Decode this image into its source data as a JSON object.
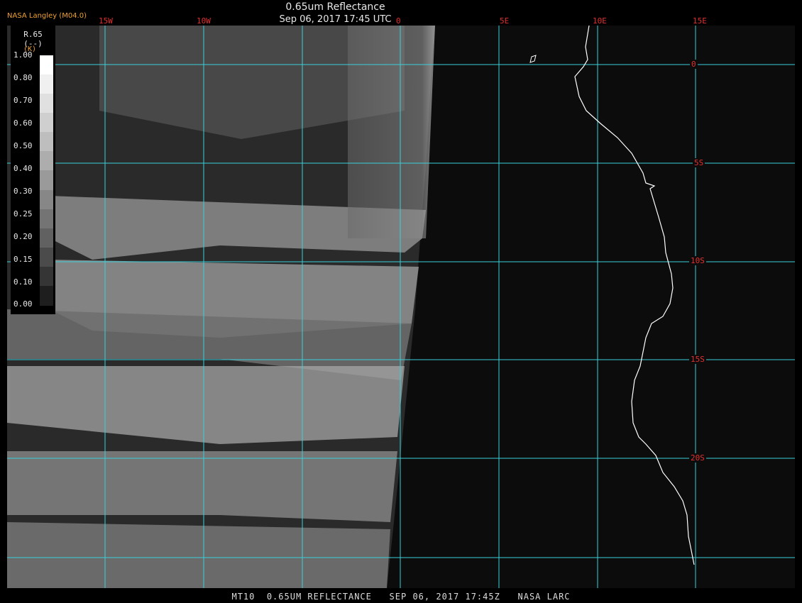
{
  "header": {
    "title": "0.65um Reflectance",
    "subtitle": "Sep 06, 2017 17:45 UTC",
    "credit": "NASA Langley (M04.0)"
  },
  "longitude_labels": [
    "15W",
    "10W",
    "0",
    "5E",
    "10E",
    "15E"
  ],
  "latitude_labels": [
    "0",
    "5S",
    "10S",
    "15S",
    "20S"
  ],
  "colorbar": {
    "label": "R.65",
    "unit": "(--)",
    "unit_k": "(K)",
    "ticks": [
      "1.00",
      "0.80",
      "0.70",
      "0.60",
      "0.50",
      "0.40",
      "0.30",
      "0.25",
      "0.20",
      "0.15",
      "0.10",
      "0.00"
    ],
    "grays": [
      "#ffffff",
      "#f0f0f0",
      "#e0e0e0",
      "#cfcfcf",
      "#bebebe",
      "#adadad",
      "#9a9a9a",
      "#878787",
      "#747474",
      "#616161",
      "#4b4b4b",
      "#353535",
      "#1e1e1e"
    ]
  },
  "colors": {
    "grid": "#38d0d8",
    "labels": "#e23030",
    "coastline": "#ffffff",
    "credit": "#f0a030"
  },
  "footer": "MT10  0.65UM REFLECTANCE   SEP 06, 2017 17:45Z   NASA LARC"
}
